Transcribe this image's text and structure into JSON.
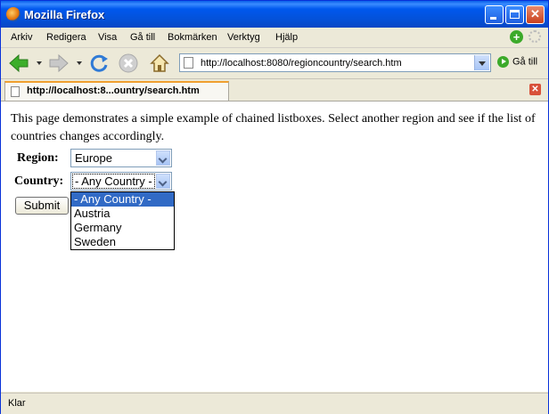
{
  "window": {
    "title": "Mozilla Firefox",
    "icons": {
      "app": "firefox-icon",
      "minimize": "minimize-icon",
      "maximize": "maximize-icon",
      "close": "close-icon"
    },
    "close_glyph": "✕"
  },
  "menu": {
    "items": [
      "Arkiv",
      "Redigera",
      "Visa",
      "Gå till",
      "Bokmärken",
      "Verktyg",
      "Hjälp"
    ]
  },
  "toolbar": {
    "url": "http://localhost:8080/regioncountry/search.htm",
    "go_label": "Gå till",
    "icons": [
      "back-icon",
      "forward-icon",
      "reload-icon",
      "stop-icon",
      "home-icon"
    ]
  },
  "tab": {
    "label": "http://localhost:8...ountry/search.htm",
    "close_glyph": "✕"
  },
  "page": {
    "intro": "This page demonstrates a simple example of chained listboxes. Select another region and see if the list of countries changes accordingly.",
    "region_label": "Region:",
    "region_value": "Europe",
    "country_label": "Country:",
    "country_value": "- Any Country -",
    "country_options": [
      "- Any Country -",
      "Austria",
      "Germany",
      "Sweden"
    ],
    "submit_label": "Submit"
  },
  "status": {
    "text": "Klar"
  },
  "colors": {
    "titlebar": "#0058ee",
    "selection": "#316ac5",
    "go_green": "#3caa2a"
  }
}
